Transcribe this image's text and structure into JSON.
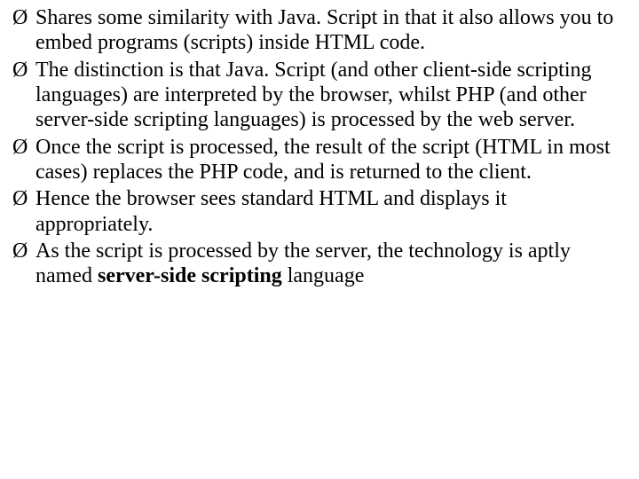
{
  "bullets": [
    {
      "segments": [
        {
          "text": "Shares some similarity with Java. Script in that it also allows you to embed programs (scripts) inside HTML code.",
          "bold": false
        }
      ]
    },
    {
      "segments": [
        {
          "text": "The distinction is that Java. Script (and other client-side scripting languages) are interpreted by the browser, whilst PHP (and other server-side scripting languages) is processed by the web server.",
          "bold": false
        }
      ]
    },
    {
      "segments": [
        {
          "text": "Once the script is processed, the result of the script (HTML in most cases) replaces the PHP code, and is returned to the client.",
          "bold": false
        }
      ]
    },
    {
      "segments": [
        {
          "text": "Hence the browser sees standard HTML and displays it appropriately.",
          "bold": false
        }
      ]
    },
    {
      "segments": [
        {
          "text": "As the script is processed by the server, the technology is aptly named ",
          "bold": false
        },
        {
          "text": "server-side scripting ",
          "bold": true
        },
        {
          "text": "language",
          "bold": false
        }
      ]
    }
  ],
  "marker": "Ø "
}
